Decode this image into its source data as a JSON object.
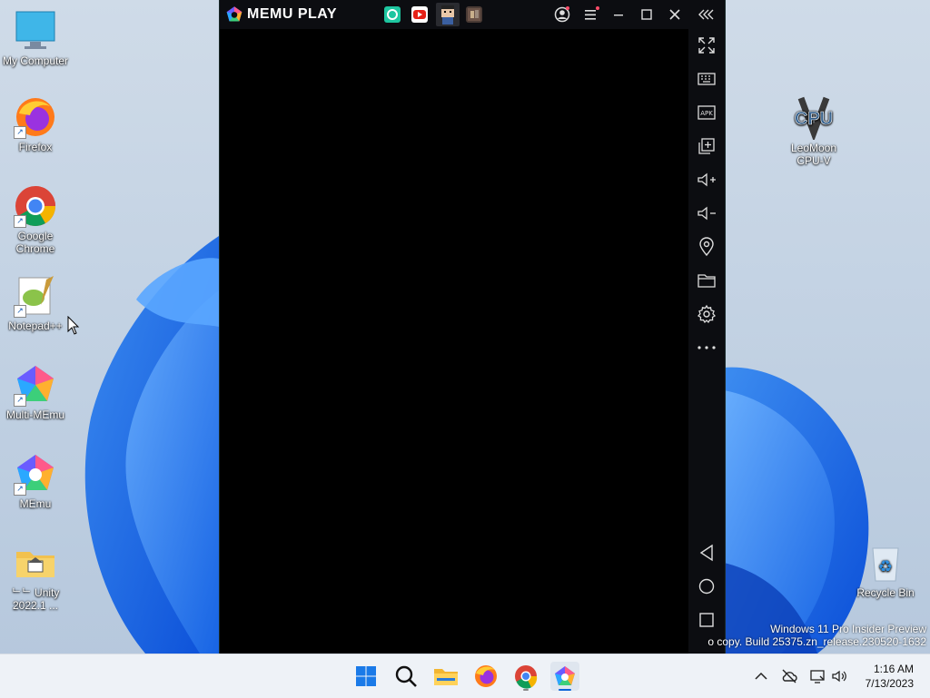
{
  "desktop": {
    "icons": [
      {
        "label": "My Computer"
      },
      {
        "label": "Firefox"
      },
      {
        "label": "Google Chrome"
      },
      {
        "label": "Notepad++"
      },
      {
        "label": "Multi-MEmu"
      },
      {
        "label": "MEmu"
      },
      {
        "label": "ᄂᄂ Unity 2022.1 ..."
      },
      {
        "label": "LeoMoon CPU-V"
      },
      {
        "label": "Recycle Bin"
      }
    ],
    "watermark": {
      "line1": "Windows 11 Pro Insider Preview",
      "line2": "o copy. Build 25375.zn_release.230520-1632"
    }
  },
  "memu": {
    "title": "MEMU PLAY",
    "tabs": [
      "app-store-icon",
      "youtube-icon",
      "game-character-icon",
      "game-icon-2"
    ],
    "sidebar": [
      "fullscreen",
      "keyboard",
      "apk",
      "multi-window",
      "volume-up",
      "volume-down",
      "location",
      "folder",
      "settings",
      "more",
      "back",
      "home",
      "recents"
    ]
  },
  "taskbar": {
    "clock_time": "1:16 AM",
    "clock_date": "7/13/2023"
  },
  "colors": {
    "memu_bg": "#0c0d11",
    "taskbar_bg": "#eef2f7",
    "accent": "#0a64d8"
  }
}
